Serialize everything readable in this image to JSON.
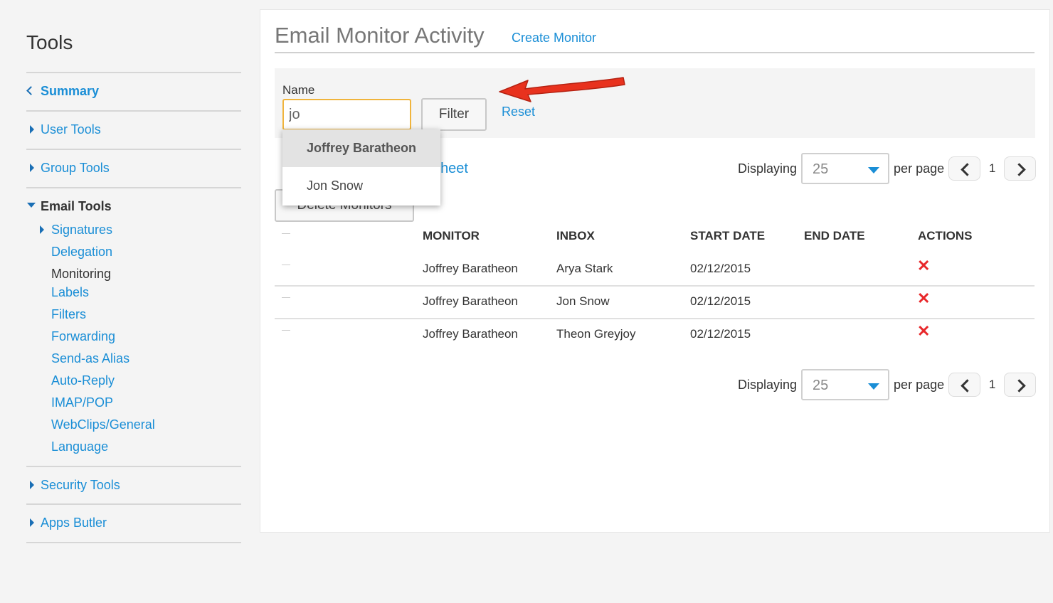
{
  "sidebar": {
    "title": "Tools",
    "summary": "Summary",
    "user_tools": "User Tools",
    "group_tools": "Group Tools",
    "email_tools": "Email Tools",
    "email_sub": [
      "Signatures",
      "Delegation",
      "Monitoring",
      "Labels",
      "Filters",
      "Forwarding",
      "Send-as Alias",
      "Auto-Reply",
      "IMAP/POP",
      "WebClips/General",
      "Language"
    ],
    "security_tools": "Security Tools",
    "apps_butler": "Apps Butler"
  },
  "header": {
    "title": "Email Monitor Activity",
    "create_link": "Create Monitor"
  },
  "filter": {
    "name_label": "Name",
    "name_value": "jo",
    "filter_button": "Filter",
    "reset_link": "Reset"
  },
  "toolbar": {
    "sheet_link_fragment": "heet",
    "delete_button": "Delete Monitors"
  },
  "autocomplete": {
    "options": [
      "Joffrey Baratheon",
      "Jon Snow"
    ]
  },
  "pagination": {
    "displaying_label": "Displaying",
    "per_page_value": "25",
    "per_page_label": "per page",
    "page": "1"
  },
  "table": {
    "headers": [
      "MONITOR",
      "INBOX",
      "START DATE",
      "END DATE",
      "ACTIONS"
    ],
    "rows": [
      {
        "monitor": "Joffrey Baratheon",
        "inbox": "Arya Stark",
        "start": "02/12/2015",
        "end": "",
        "action": "✕"
      },
      {
        "monitor": "Joffrey Baratheon",
        "inbox": "Jon Snow",
        "start": "02/12/2015",
        "end": "",
        "action": "✕"
      },
      {
        "monitor": "Joffrey Baratheon",
        "inbox": "Theon Greyjoy",
        "start": "02/12/2015",
        "end": "",
        "action": "✕"
      }
    ]
  },
  "colors": {
    "link": "#1a8ed6",
    "input_focus_border": "#f0b43c",
    "delete_icon": "#e8282b",
    "annotation_arrow": "#e8321e"
  },
  "icons": [
    "chevron-left-icon",
    "triangle-right-icon",
    "triangle-down-icon",
    "dropdown-caret-icon",
    "delete-x-icon",
    "annotation-arrow"
  ]
}
